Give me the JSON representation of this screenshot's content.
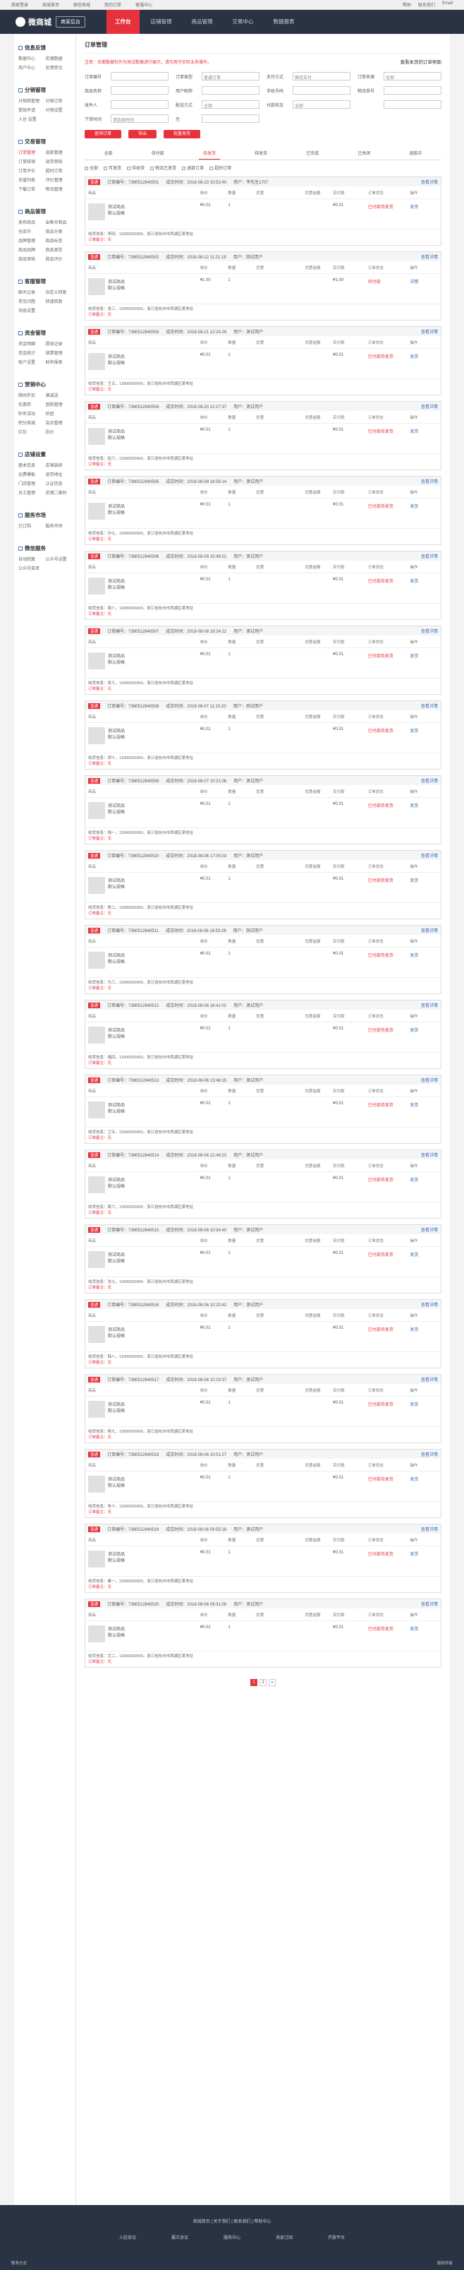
{
  "topbar": {
    "items": [
      "商家登录",
      "商城首页",
      "微信商城",
      "我的订单",
      "客服中心"
    ],
    "right": [
      "帮助",
      "联系我们",
      "Email"
    ]
  },
  "header": {
    "logo": "微商城",
    "sub": "商家后台",
    "nav": [
      "工作台",
      "店铺管理",
      "商品管理",
      "交易中心",
      "数据报表"
    ],
    "active": "工作台"
  },
  "sidebar": [
    {
      "title": "信息反馈",
      "items": [
        "数据中心",
        "店铺数据",
        "用户中心",
        "反馈意见"
      ]
    },
    {
      "title": "分销管理",
      "items": [
        "分销商管理",
        "分销订单",
        "提现申请",
        "分销设置",
        "入住 设置"
      ]
    },
    {
      "title": "交易管理",
      "items": [
        "订单管理",
        "退款管理",
        "订单核销",
        "退货审核",
        "订单评价",
        "超时订单",
        "充值列表",
        "评价管理",
        "下载订单",
        "物流管理"
      ]
    },
    {
      "title": "商品管理",
      "items": [
        "发布商品",
        "出售中商品",
        "仓库中",
        "商品分类",
        "品牌管理",
        "商品标签",
        "商品品牌",
        "商品类型",
        "商品审核",
        "商品评价"
      ]
    },
    {
      "title": "客服管理",
      "items": [
        "聊天记录",
        "自定义回复",
        "常见问题",
        "快速回复",
        "消息设置"
      ]
    },
    {
      "title": "资金管理",
      "items": [
        "资金明细",
        "提现记录",
        "资金统计",
        "结算管理",
        "账户设置",
        "财务报表"
      ]
    },
    {
      "title": "营销中心",
      "items": [
        "限时折扣",
        "满减送",
        "优惠券",
        "团购管理",
        "秒杀活动",
        "拼团",
        "积分商城",
        "会员管理",
        "红包",
        "砍价"
      ]
    },
    {
      "title": "店铺设置",
      "items": [
        "基本信息",
        "店铺装修",
        "运费模板",
        "退货地址",
        "门店管理",
        "认证信息",
        "员工管理",
        "店铺二维码"
      ]
    },
    {
      "title": "服务市场",
      "items": [
        "已订购",
        "服务市场"
      ]
    },
    {
      "title": "微信服务",
      "items": [
        "自动回复",
        "公众号设置",
        "公众号菜单"
      ]
    }
  ],
  "main": {
    "title": "订单管理",
    "tip": "注意：页面数据仅作为测试数据进行展示，请勿用于实际业务操作。",
    "help": "查看本页的订单帮助",
    "filters": [
      {
        "label": "订单编号",
        "value": ""
      },
      {
        "label": "订单类型",
        "value": "普通订单"
      },
      {
        "label": "支付方式",
        "value": "微信支付"
      },
      {
        "label": "订单来源",
        "value": "全部"
      },
      {
        "label": "商品名称",
        "value": ""
      },
      {
        "label": "用户昵称",
        "value": ""
      },
      {
        "label": "手机号码",
        "value": ""
      },
      {
        "label": "物流单号",
        "value": ""
      },
      {
        "label": "收件人",
        "value": ""
      },
      {
        "label": "配送方式",
        "value": "全部"
      },
      {
        "label": "付款状态",
        "value": "全部"
      },
      {
        "label": "",
        "value": ""
      },
      {
        "label": "下单时间",
        "value": "请选择时间"
      },
      {
        "label": "至",
        "value": ""
      }
    ],
    "buttons": [
      "查询订单",
      "导出",
      "批量发货"
    ],
    "tabs": [
      "全部",
      "待付款",
      "待发货",
      "待收货",
      "已完成",
      "已关闭",
      "退款中"
    ],
    "active_tab": "待发货",
    "checks": [
      "全部",
      "可发货",
      "待收货",
      "物流已发货",
      "退款订单",
      "超时订单"
    ],
    "columns": [
      "商品",
      "单价",
      "数量",
      "优惠",
      "优惠金额",
      "实付款",
      "订单状态",
      "操作"
    ],
    "orders": [
      {
        "no": "订单编号：7380512840501",
        "type": "普通",
        "time": "成交时间：2018-08-23 10:52:40",
        "buyer": "用户：李先生1707",
        "product": "测试商品",
        "spec": "默认规格",
        "price": "¥0.01",
        "qty": "1",
        "pay": "¥0.01",
        "status": "已付款待发货",
        "op": "发货",
        "addr": "收货信息：李四，13000000000，浙江省杭州市西湖区某地址",
        "remark": "订单备注：无"
      },
      {
        "no": "订单编号：7380512840502",
        "type": "普通",
        "time": "成交时间：2018-08-22 11:21:19",
        "buyer": "用户：测试用户",
        "product": "测试商品",
        "spec": "默认规格",
        "price": "¥1.00",
        "qty": "1",
        "pay": "¥1.00",
        "status": "待付款",
        "op": "详情",
        "addr": "收货信息：张三，13000000000，浙江省杭州市西湖区某地址",
        "remark": "订单备注：无"
      },
      {
        "no": "订单编号：7380512840503",
        "type": "普通",
        "time": "成交时间：2018-08-21 12:24:29",
        "buyer": "用户：测试用户",
        "product": "测试商品",
        "spec": "默认规格",
        "price": "¥0.01",
        "qty": "1",
        "pay": "¥0.01",
        "status": "已付款待发货",
        "op": "发货",
        "addr": "收货信息：王五，13000000000，浙江省杭州市西湖区某地址",
        "remark": "订单备注：无"
      },
      {
        "no": "订单编号：7380512840504",
        "type": "普通",
        "time": "成交时间：2018-08-20 12:17:37",
        "buyer": "用户：测试用户",
        "product": "测试商品",
        "spec": "默认规格",
        "price": "¥0.01",
        "qty": "1",
        "pay": "¥0.01",
        "status": "已付款待发货",
        "op": "发货",
        "addr": "收货信息：赵六，13000000000，浙江省杭州市西湖区某地址",
        "remark": "订单备注：无"
      },
      {
        "no": "订单编号：7380512840505",
        "type": "普通",
        "time": "成交时间：2018-08-09 16:56:14",
        "buyer": "用户：测试用户",
        "product": "测试商品",
        "spec": "默认规格",
        "price": "¥0.01",
        "qty": "1",
        "pay": "¥0.01",
        "status": "已付款待发货",
        "op": "发货",
        "addr": "收货信息：孙七，13000000000，浙江省杭州市西湖区某地址",
        "remark": "订单备注：无"
      },
      {
        "no": "订单编号：7380512840506",
        "type": "普通",
        "time": "成交时间：2018-08-09 15:49:22",
        "buyer": "用户：测试用户",
        "product": "测试商品",
        "spec": "默认规格",
        "price": "¥0.01",
        "qty": "1",
        "pay": "¥0.01",
        "status": "已付款待发货",
        "op": "发货",
        "addr": "收货信息：周八，13000000000，浙江省杭州市西湖区某地址",
        "remark": "订单备注：无"
      },
      {
        "no": "订单编号：7380512840507",
        "type": "普通",
        "time": "成交时间：2018-08-08 18:24:12",
        "buyer": "用户：测试用户",
        "product": "测试商品",
        "spec": "默认规格",
        "price": "¥0.01",
        "qty": "1",
        "pay": "¥0.01",
        "status": "已付款待发货",
        "op": "发货",
        "addr": "收货信息：吴九，13000000000，浙江省杭州市西湖区某地址",
        "remark": "订单备注：无"
      },
      {
        "no": "订单编号：7380512840508",
        "type": "普通",
        "time": "成交时间：2018-08-07 11:15:20",
        "buyer": "用户：测试用户",
        "product": "测试商品",
        "spec": "默认规格",
        "price": "¥0.01",
        "qty": "1",
        "pay": "¥0.01",
        "status": "已付款待发货",
        "op": "发货",
        "addr": "收货信息：郑十，13000000000，浙江省杭州市西湖区某地址",
        "remark": "订单备注：无"
      },
      {
        "no": "订单编号：7380512840509",
        "type": "普通",
        "time": "成交时间：2018-08-07 10:21:06",
        "buyer": "用户：测试用户",
        "product": "测试商品",
        "spec": "默认规格",
        "price": "¥0.01",
        "qty": "1",
        "pay": "¥0.01",
        "status": "已付款待发货",
        "op": "发货",
        "addr": "收货信息：钱一，13000000000，浙江省杭州市西湖区某地址",
        "remark": "订单备注：无"
      },
      {
        "no": "订单编号：7380512840510",
        "type": "普通",
        "time": "成交时间：2018-08-06 17:05:03",
        "buyer": "用户：测试用户",
        "product": "测试商品",
        "spec": "默认规格",
        "price": "¥0.01",
        "qty": "1",
        "pay": "¥0.01",
        "status": "已付款待发货",
        "op": "发货",
        "addr": "收货信息：陈二，13000000000，浙江省杭州市西湖区某地址",
        "remark": "订单备注：无"
      },
      {
        "no": "订单编号：7380512840511",
        "type": "普通",
        "time": "成交时间：2018-08-06 16:53:28",
        "buyer": "用户：测试用户",
        "product": "测试商品",
        "spec": "默认规格",
        "price": "¥0.01",
        "qty": "1",
        "pay": "¥0.01",
        "status": "已付款待发货",
        "op": "发货",
        "addr": "收货信息：冯三，13000000000，浙江省杭州市西湖区某地址",
        "remark": "订单备注：无"
      },
      {
        "no": "订单编号：7380512840512",
        "type": "普通",
        "time": "成交时间：2018-08-06 16:41:02",
        "buyer": "用户：测试用户",
        "product": "测试商品",
        "spec": "默认规格",
        "price": "¥0.01",
        "qty": "1",
        "pay": "¥0.01",
        "status": "已付款待发货",
        "op": "发货",
        "addr": "收货信息：褚四，13000000000，浙江省杭州市西湖区某地址",
        "remark": "订单备注：无"
      },
      {
        "no": "订单编号：7380512840513",
        "type": "普通",
        "time": "成交时间：2018-08-06 13:48:15",
        "buyer": "用户：测试用户",
        "product": "测试商品",
        "spec": "默认规格",
        "price": "¥0.01",
        "qty": "1",
        "pay": "¥0.01",
        "status": "已付款待发货",
        "op": "发货",
        "addr": "收货信息：卫五，13000000000，浙江省杭州市西湖区某地址",
        "remark": "订单备注：无"
      },
      {
        "no": "订单编号：7380512840514",
        "type": "普通",
        "time": "成交时间：2018-08-06 12:46:23",
        "buyer": "用户：测试用户",
        "product": "测试商品",
        "spec": "默认规格",
        "price": "¥0.01",
        "qty": "1",
        "pay": "¥0.01",
        "status": "已付款待发货",
        "op": "发货",
        "addr": "收货信息：蒋六，13000000000，浙江省杭州市西湖区某地址",
        "remark": "订单备注：无"
      },
      {
        "no": "订单编号：7380512840515",
        "type": "普通",
        "time": "成交时间：2018-08-06 10:34:40",
        "buyer": "用户：测试用户",
        "product": "测试商品",
        "spec": "默认规格",
        "price": "¥0.01",
        "qty": "1",
        "pay": "¥0.01",
        "status": "已付款待发货",
        "op": "发货",
        "addr": "收货信息：沈七，13000000000，浙江省杭州市西湖区某地址",
        "remark": "订单备注：无"
      },
      {
        "no": "订单编号：7380512840516",
        "type": "普通",
        "time": "成交时间：2018-08-06 10:20:42",
        "buyer": "用户：测试用户",
        "product": "测试商品",
        "spec": "默认规格",
        "price": "¥0.01",
        "qty": "1",
        "pay": "¥0.01",
        "status": "已付款待发货",
        "op": "发货",
        "addr": "收货信息：韩八，13000000000，浙江省杭州市西湖区某地址",
        "remark": "订单备注：无"
      },
      {
        "no": "订单编号：7380512840517",
        "type": "普通",
        "time": "成交时间：2018-08-06 10:19:37",
        "buyer": "用户：测试用户",
        "product": "测试商品",
        "spec": "默认规格",
        "price": "¥0.01",
        "qty": "1",
        "pay": "¥0.01",
        "status": "已付款待发货",
        "op": "发货",
        "addr": "收货信息：杨九，13000000000，浙江省杭州市西湖区某地址",
        "remark": "订单备注：无"
      },
      {
        "no": "订单编号：7380512840518",
        "type": "普通",
        "time": "成交时间：2018-08-06 10:01:27",
        "buyer": "用户：测试用户",
        "product": "测试商品",
        "spec": "默认规格",
        "price": "¥0.01",
        "qty": "1",
        "pay": "¥0.01",
        "status": "已付款待发货",
        "op": "发货",
        "addr": "收货信息：朱十，13000000000，浙江省杭州市西湖区某地址",
        "remark": "订单备注：无"
      },
      {
        "no": "订单编号：7380512840519",
        "type": "普通",
        "time": "成交时间：2018-08-06 09:55:18",
        "buyer": "用户：测试用户",
        "product": "测试商品",
        "spec": "默认规格",
        "price": "¥0.01",
        "qty": "1",
        "pay": "¥0.01",
        "status": "已付款待发货",
        "op": "发货",
        "addr": "收货信息：秦一，13000000000，浙江省杭州市西湖区某地址",
        "remark": "订单备注：无"
      },
      {
        "no": "订单编号：7380512840520",
        "type": "普通",
        "time": "成交时间：2018-08-06 09:31:09",
        "buyer": "用户：测试用户",
        "product": "测试商品",
        "spec": "默认规格",
        "price": "¥0.01",
        "qty": "1",
        "pay": "¥0.01",
        "status": "已付款待发货",
        "op": "发货",
        "addr": "收货信息：尤二，13000000000，浙江省杭州市西湖区某地址",
        "remark": "订单备注：无"
      }
    ],
    "pager": [
      "1",
      "2",
      "»"
    ]
  },
  "footer": {
    "links": "商城首页 | 关于我们 | 联系我们 | 帮助中心",
    "cols": [
      "入驻协议",
      "霸王协议",
      "服务中心",
      "消息订阅",
      "开放平台"
    ],
    "left": "联系方式",
    "right": "版权所有"
  }
}
